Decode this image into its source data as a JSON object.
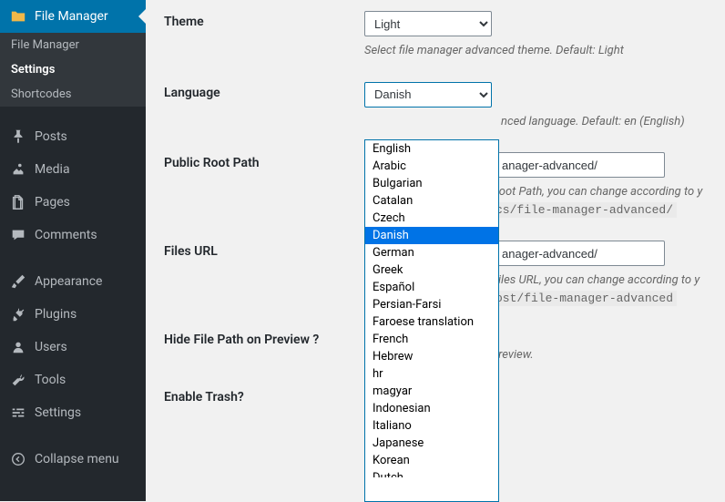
{
  "sidebar": {
    "active": {
      "icon": "folder",
      "label": "File Manager"
    },
    "sub": [
      {
        "label": "File Manager",
        "active": false
      },
      {
        "label": "Settings",
        "active": true
      },
      {
        "label": "Shortcodes",
        "active": false
      }
    ],
    "items": [
      {
        "icon": "pin",
        "label": "Posts"
      },
      {
        "icon": "media",
        "label": "Media"
      },
      {
        "icon": "page",
        "label": "Pages"
      },
      {
        "icon": "comment",
        "label": "Comments"
      }
    ],
    "items2": [
      {
        "icon": "brush",
        "label": "Appearance"
      },
      {
        "icon": "plug",
        "label": "Plugins"
      },
      {
        "icon": "user",
        "label": "Users"
      },
      {
        "icon": "wrench",
        "label": "Tools"
      },
      {
        "icon": "sliders",
        "label": "Settings"
      }
    ],
    "collapse": {
      "icon": "collapse",
      "label": "Collapse menu"
    }
  },
  "form": {
    "theme": {
      "label": "Theme",
      "value": "Light",
      "desc": "Select file manager advanced theme. Default: Light"
    },
    "language": {
      "label": "Language",
      "value": "Danish",
      "desc_suffix": "nced language. Default: en (English)"
    },
    "root_path": {
      "label": "Public Root Path",
      "placeholder": "anager-advanced/",
      "desc1": "Root Path, you can change according to y",
      "code": "cs/file-manager-advanced/"
    },
    "files_url": {
      "label": "Files URL",
      "placeholder": "anager-advanced/",
      "desc1": "Files URL, you can change according to y",
      "code": "ost/file-manager-advanced"
    },
    "hide_path": {
      "label": "Hide File Path on Preview ?",
      "desc": "preview."
    },
    "trash": {
      "label": "Enable Trash?"
    }
  },
  "dropdown": {
    "options": [
      "English",
      "Arabic",
      "Bulgarian",
      "Catalan",
      "Czech",
      "Danish",
      "German",
      "Greek",
      "Español",
      "Persian-Farsi",
      "Faroese translation",
      "French",
      "Hebrew",
      "hr",
      "magyar",
      "Indonesian",
      "Italiano",
      "Japanese",
      "Korean",
      "Dutch"
    ],
    "selected": "Danish"
  }
}
